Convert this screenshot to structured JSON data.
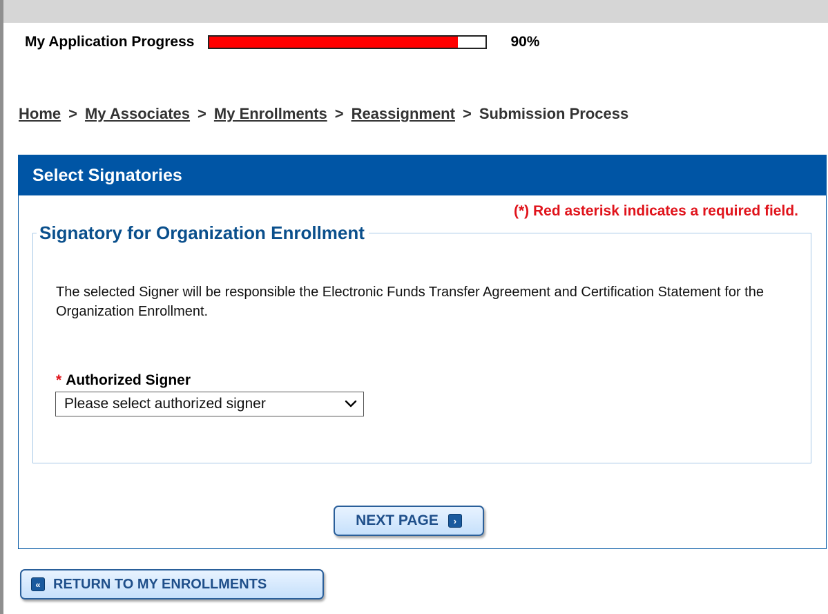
{
  "progress": {
    "label": "My Application Progress",
    "value": 0.9,
    "percent_text": "90%",
    "fill_color": "#ff0000"
  },
  "breadcrumb": {
    "links": [
      "Home",
      "My Associates",
      "My Enrollments",
      "Reassignment"
    ],
    "separator": ">",
    "current": "Submission Process"
  },
  "panel": {
    "title": "Select Signatories",
    "required_note": "(*) Red asterisk indicates a required field.",
    "fieldset_legend": "Signatory for Organization Enrollment",
    "description": "The selected Signer will be responsible the Electronic Funds Transfer Agreement and Certification Statement for the Organization Enrollment.",
    "signer_field": {
      "asterisk": "*",
      "label": "Authorized Signer",
      "selected": "Please select authorized signer"
    },
    "next_button": "NEXT PAGE"
  },
  "return_button": "RETURN TO MY ENROLLMENTS",
  "colors": {
    "header_blue": "#0055a5",
    "required_red": "#e0131b",
    "legend_blue": "#0a4f8c"
  },
  "icons": {
    "next": "chevron-right-icon",
    "back": "double-chevron-left-icon",
    "dropdown": "chevron-down-icon"
  }
}
